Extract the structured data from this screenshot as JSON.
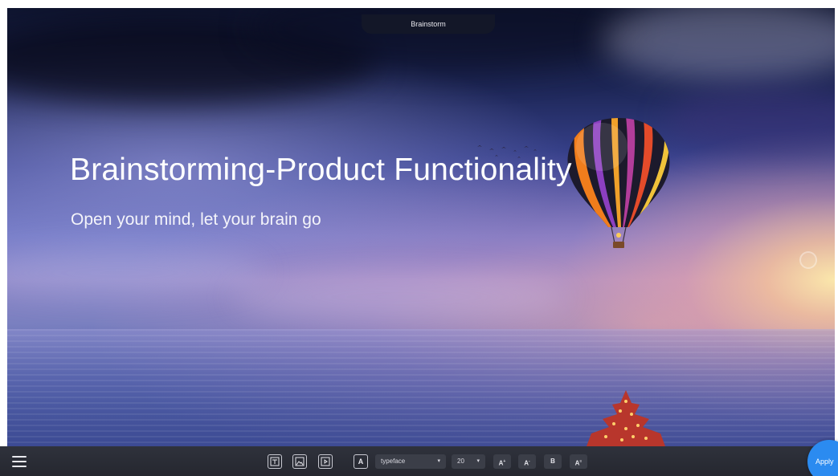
{
  "window": {
    "title": "Brainstorm"
  },
  "slide": {
    "title": "Brainstorming-Product Functionality",
    "subtitle": "Open your mind, let your brain go",
    "background_image": "hot-air-balloon-over-sea-at-sunset"
  },
  "toolbar": {
    "menu_icon": "hamburger-menu-icon",
    "layout_icons": [
      "text-layout-icon",
      "image-layout-icon",
      "play-layout-icon"
    ],
    "text_style_icon": "text-frame-icon",
    "text_style_label": "A",
    "typeface": {
      "value": "typeface",
      "caret": "▾"
    },
    "font_size": {
      "value": "20",
      "caret": "▾"
    },
    "grow_font_label": "A",
    "grow_font_sup": "+",
    "shrink_font_label": "A",
    "shrink_font_sup": "-",
    "bold_label": "B",
    "effect_label": "A",
    "effect_sup": "≡"
  },
  "apply_button": {
    "label": "Apply"
  },
  "colors": {
    "toolbar_bg": "#2a2c35",
    "accent": "#2b8bf0",
    "title_text": "#ffffff"
  }
}
